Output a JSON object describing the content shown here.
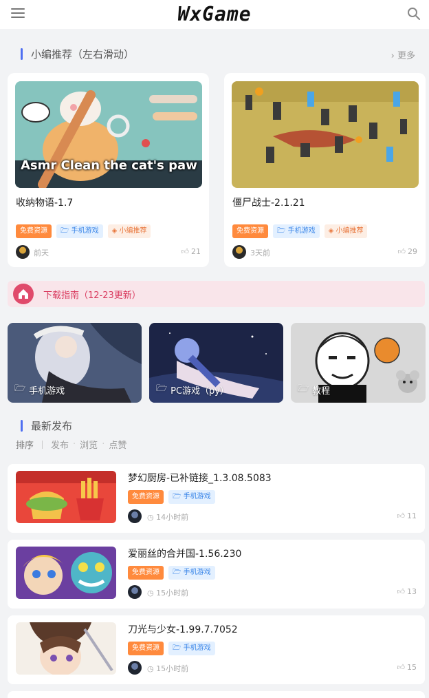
{
  "header": {
    "brand": "WxGame"
  },
  "featured": {
    "title": "小编推荐（左右滑动）",
    "more": "› 更多",
    "items": [
      {
        "image_caption": "Asmr Clean the cat's paw",
        "title": "收纳物语-1.7",
        "tags": [
          "免费资源",
          "手机游戏",
          "小编推荐"
        ],
        "time": "前天",
        "likes": "21"
      },
      {
        "title": "僵尸战士-2.1.21",
        "tags": [
          "免费资源",
          "手机游戏",
          "小编推荐"
        ],
        "time": "3天前",
        "likes": "29"
      }
    ]
  },
  "notice": {
    "text": "下载指南（12-23更新）"
  },
  "categories": [
    {
      "label": "手机游戏"
    },
    {
      "label": "PC游戏（py）"
    },
    {
      "label": "教程"
    }
  ],
  "latest": {
    "title": "最新发布",
    "sort": {
      "lead": "排序",
      "options": [
        "发布",
        "浏览",
        "点赞"
      ]
    },
    "posts": [
      {
        "title": "梦幻厨房-已补链接_1.3.08.5083",
        "tags": [
          "免费资源",
          "手机游戏"
        ],
        "time": "14小时前",
        "likes": "11"
      },
      {
        "title": "爱丽丝的合并国-1.56.230",
        "tags": [
          "免费资源",
          "手机游戏"
        ],
        "time": "15小时前",
        "likes": "13"
      },
      {
        "title": "刀光与少女-1.99.7.7052",
        "tags": [
          "免费资源",
          "手机游戏"
        ],
        "time": "15小时前",
        "likes": "15"
      }
    ]
  },
  "colors": {
    "accent": "#4f6ff1",
    "tag_free": "#ff8a3d",
    "tag_mobile": "#3b86e8",
    "notice": "#d93a5e"
  }
}
